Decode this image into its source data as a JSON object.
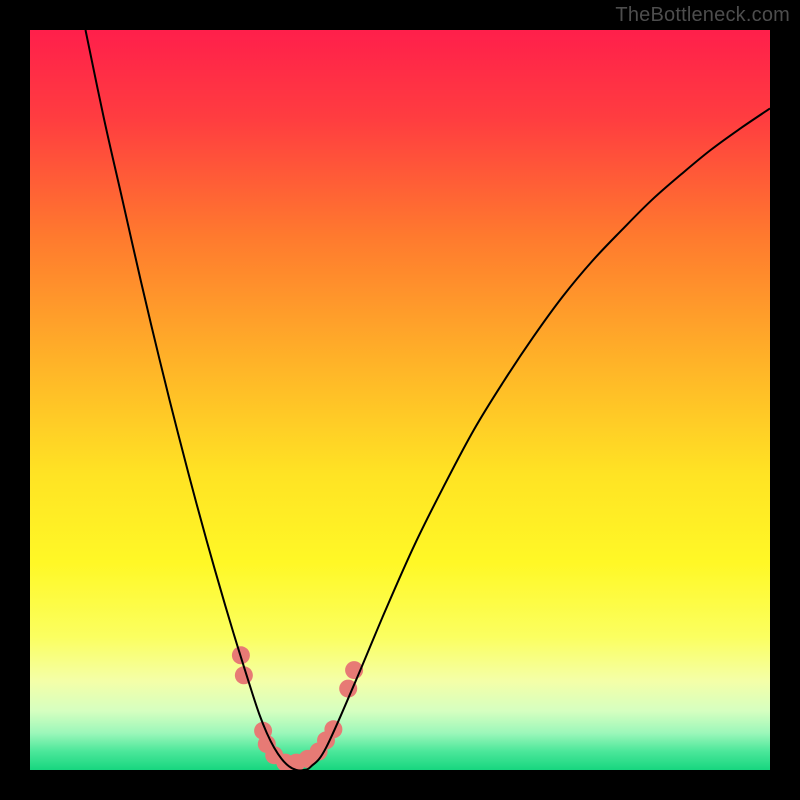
{
  "watermark": "TheBottleneck.com",
  "chart_data": {
    "type": "line",
    "title": "",
    "xlabel": "",
    "ylabel": "",
    "xlim": [
      0,
      1
    ],
    "ylim": [
      0,
      1
    ],
    "background_gradient": {
      "stops": [
        {
          "offset": 0.0,
          "color": "#ff1f4b"
        },
        {
          "offset": 0.12,
          "color": "#ff3d40"
        },
        {
          "offset": 0.28,
          "color": "#ff7a2e"
        },
        {
          "offset": 0.45,
          "color": "#ffb328"
        },
        {
          "offset": 0.6,
          "color": "#ffe324"
        },
        {
          "offset": 0.72,
          "color": "#fff826"
        },
        {
          "offset": 0.82,
          "color": "#fbff60"
        },
        {
          "offset": 0.88,
          "color": "#f4ffa8"
        },
        {
          "offset": 0.92,
          "color": "#d6ffc0"
        },
        {
          "offset": 0.95,
          "color": "#9cf7ba"
        },
        {
          "offset": 0.975,
          "color": "#4be79a"
        },
        {
          "offset": 1.0,
          "color": "#17d67f"
        }
      ]
    },
    "series": [
      {
        "name": "bottleneck-curve",
        "color": "#000000",
        "stroke_width": 2,
        "x": [
          0.075,
          0.1,
          0.125,
          0.15,
          0.175,
          0.2,
          0.225,
          0.25,
          0.275,
          0.3,
          0.31,
          0.32,
          0.33,
          0.34,
          0.35,
          0.36,
          0.37,
          0.38,
          0.4,
          0.44,
          0.48,
          0.52,
          0.56,
          0.6,
          0.64,
          0.68,
          0.72,
          0.76,
          0.8,
          0.84,
          0.88,
          0.92,
          0.96,
          1.0
        ],
        "y": [
          1.0,
          0.88,
          0.77,
          0.66,
          0.555,
          0.455,
          0.36,
          0.27,
          0.185,
          0.105,
          0.075,
          0.05,
          0.03,
          0.015,
          0.005,
          0.0,
          0.0,
          0.005,
          0.03,
          0.12,
          0.215,
          0.305,
          0.385,
          0.46,
          0.525,
          0.585,
          0.64,
          0.688,
          0.73,
          0.77,
          0.805,
          0.838,
          0.867,
          0.894
        ]
      }
    ],
    "markers": {
      "name": "highlight-dots",
      "color": "#e77a75",
      "radius": 9,
      "points": [
        {
          "x": 0.285,
          "y": 0.155
        },
        {
          "x": 0.289,
          "y": 0.128
        },
        {
          "x": 0.315,
          "y": 0.053
        },
        {
          "x": 0.32,
          "y": 0.035
        },
        {
          "x": 0.33,
          "y": 0.02
        },
        {
          "x": 0.345,
          "y": 0.01
        },
        {
          "x": 0.36,
          "y": 0.01
        },
        {
          "x": 0.375,
          "y": 0.015
        },
        {
          "x": 0.39,
          "y": 0.025
        },
        {
          "x": 0.4,
          "y": 0.04
        },
        {
          "x": 0.41,
          "y": 0.055
        },
        {
          "x": 0.43,
          "y": 0.11
        },
        {
          "x": 0.438,
          "y": 0.135
        }
      ]
    }
  }
}
